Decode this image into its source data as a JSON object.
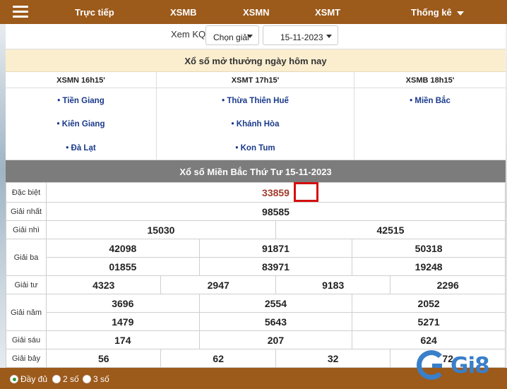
{
  "nav": {
    "items": [
      "Trực tiếp",
      "XSMB",
      "XSMN",
      "XSMT"
    ],
    "stats_label": "Thống kê"
  },
  "search": {
    "label": "Xem KQ:",
    "province_select": "Chọn giải",
    "date_select": "15-11-2023"
  },
  "today": {
    "title": "Xổ số mở thưởng ngày hôm nay",
    "regions": [
      {
        "name": "XSMN 16h15'",
        "provinces": [
          "Tiền Giang",
          "Kiên Giang",
          "Đà Lạt"
        ]
      },
      {
        "name": "XSMT 17h15'",
        "provinces": [
          "Thừa Thiên Huế",
          "Khánh Hòa",
          "Kon Tum"
        ]
      },
      {
        "name": "XSMB 18h15'",
        "provinces": [
          "Miền Bắc"
        ]
      }
    ]
  },
  "results": {
    "title": "Xổ số Miền Bắc Thứ Tư 15-11-2023",
    "prizes": {
      "special": {
        "name": "Đặc biệt",
        "numbers": [
          "33859"
        ]
      },
      "first": {
        "name": "Giải nhất",
        "numbers": [
          "98585"
        ]
      },
      "second": {
        "name": "Giải nhì",
        "numbers": [
          "15030",
          "42515"
        ]
      },
      "third": {
        "name": "Giải ba",
        "numbers": [
          "42098",
          "91871",
          "50318",
          "01855",
          "83971",
          "19248"
        ]
      },
      "fourth": {
        "name": "Giải tư",
        "numbers": [
          "4323",
          "2947",
          "9183",
          "2296"
        ]
      },
      "fifth": {
        "name": "Giải năm",
        "numbers": [
          "3696",
          "2554",
          "2052",
          "1479",
          "5643",
          "5271"
        ]
      },
      "sixth": {
        "name": "Giải sáu",
        "numbers": [
          "174",
          "207",
          "624"
        ]
      },
      "seventh": {
        "name": "Giải bảy",
        "numbers": [
          "56",
          "62",
          "32",
          "72"
        ]
      }
    }
  },
  "footer": {
    "options": [
      "Đầy đủ",
      "2 số",
      "3 số"
    ],
    "selected": "Đầy đủ"
  },
  "logo": {
    "text": "Gi8"
  },
  "colors": {
    "brand_brown": "#9c5a1b",
    "special_prize": "#a33a2a",
    "province_link": "#1a3a8a",
    "highlight_box": "#d40f0f",
    "logo_blue": "#3a7fc9"
  }
}
